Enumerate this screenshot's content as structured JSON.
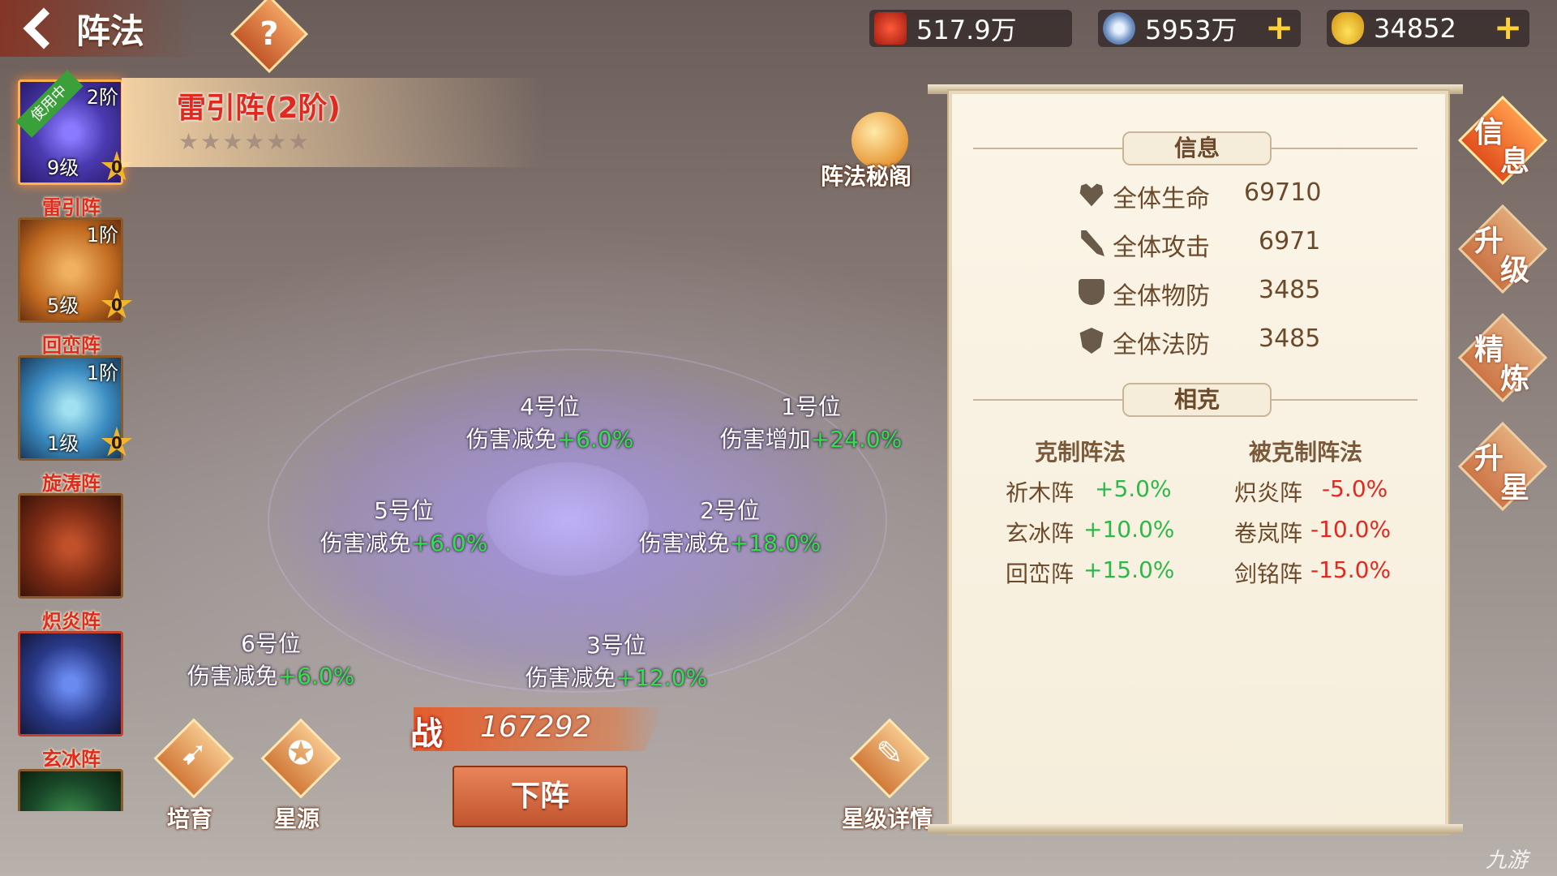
{
  "header": {
    "title": "阵法",
    "help_glyph": "?"
  },
  "resources": {
    "power": "517.9万",
    "silver": "5953万",
    "gold": "34852",
    "plus_glyph": "+"
  },
  "formations": [
    {
      "name": "雷引阵",
      "tier": "2阶",
      "level": "9级",
      "stars": "0",
      "in_use": "使用中",
      "color": "#5a4ad0"
    },
    {
      "name": "回峦阵",
      "tier": "1阶",
      "level": "5级",
      "stars": "0",
      "color": "#d88a30"
    },
    {
      "name": "旋涛阵",
      "tier": "1阶",
      "level": "1级",
      "stars": "0",
      "color": "#3a8ac0"
    },
    {
      "name": "炽炎阵",
      "color": "#8a2a1a"
    },
    {
      "name": "玄冰阵",
      "color": "#2a3a8a"
    },
    {
      "color": "#1a4a2a"
    }
  ],
  "selected": {
    "name": "雷引阵(2阶)",
    "stars": "★★★★★★"
  },
  "secret": {
    "label": "阵法秘阁"
  },
  "slots": [
    {
      "title": "4号位",
      "effect": "伤害减免",
      "value": "+6.0%"
    },
    {
      "title": "1号位",
      "effect": "伤害增加",
      "value": "+24.0%"
    },
    {
      "title": "5号位",
      "effect": "伤害减免",
      "value": "+6.0%"
    },
    {
      "title": "2号位",
      "effect": "伤害减免",
      "value": "+18.0%"
    },
    {
      "title": "6号位",
      "effect": "伤害减免",
      "value": "+6.0%"
    },
    {
      "title": "3号位",
      "effect": "伤害减免",
      "value": "+12.0%"
    }
  ],
  "power": {
    "icon": "战",
    "value": "167292"
  },
  "buttons": {
    "unequip": "下阵",
    "cultivate": "培育",
    "star_source": "星源",
    "star_detail": "星级详情"
  },
  "info_panel": {
    "info_title": "信息",
    "stats": [
      {
        "label": "全体生命",
        "value": "69710"
      },
      {
        "label": "全体攻击",
        "value": "6971"
      },
      {
        "label": "全体物防",
        "value": "3485"
      },
      {
        "label": "全体法防",
        "value": "3485"
      }
    ],
    "relation_title": "相克",
    "counter_head": "克制阵法",
    "countered_head": "被克制阵法",
    "counters": [
      {
        "name": "祈木阵",
        "value": "+5.0%"
      },
      {
        "name": "玄冰阵",
        "value": "+10.0%"
      },
      {
        "name": "回峦阵",
        "value": "+15.0%"
      }
    ],
    "countered": [
      {
        "name": "炽炎阵",
        "value": "-5.0%"
      },
      {
        "name": "卷岚阵",
        "value": "-10.0%"
      },
      {
        "name": "剑铭阵",
        "value": "-15.0%"
      }
    ]
  },
  "side_tabs": [
    {
      "c1": "信",
      "c2": "息"
    },
    {
      "c1": "升",
      "c2": "级"
    },
    {
      "c1": "精",
      "c2": "炼"
    },
    {
      "c1": "升",
      "c2": "星"
    }
  ],
  "watermark": "九游"
}
